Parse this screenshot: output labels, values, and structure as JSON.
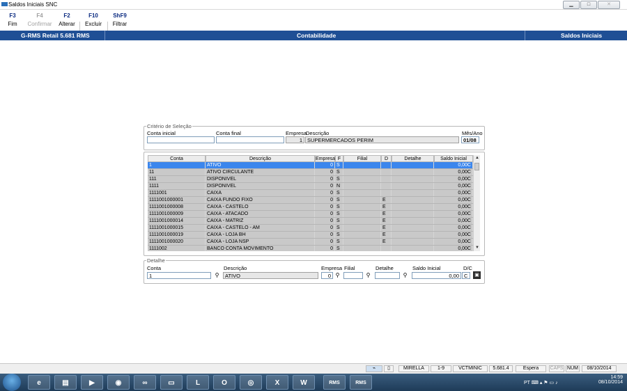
{
  "window": {
    "title": "Saldos Iniciais SNC",
    "min": "▁",
    "max": "□",
    "close": "✕"
  },
  "toolbar": [
    {
      "key": "F3",
      "label": "Fim",
      "disabled": false
    },
    {
      "key": "F4",
      "label": "Confirmar",
      "disabled": true
    },
    {
      "key": "F2",
      "label": "Alterar",
      "disabled": false
    },
    {
      "key": "F10",
      "label": "Excluir",
      "disabled": false
    },
    {
      "key": "ShF9",
      "label": "Filtrar",
      "disabled": false
    }
  ],
  "sysbar": {
    "product": "G-RMS Retail 5.681 RMS",
    "module": "Contabilidade",
    "screen": "Saldos Iniciais"
  },
  "criteria": {
    "legend": "Critério de Seleção",
    "conta_inicial_label": "Conta inicial",
    "conta_inicial": "",
    "conta_final_label": "Conta final",
    "conta_final": "",
    "empresa_label": "Empresa",
    "empresa": "1",
    "descricao_label": "Descrição",
    "descricao": "SUPERMERCADOS PERIM",
    "mes_ano_label": "Mês/Ano",
    "mes_ano": "01/08"
  },
  "grid": {
    "headers": [
      "Conta",
      "Descrição",
      "Empresa",
      "F",
      "Filial",
      "D",
      "Detalhe",
      "Saldo Inicial"
    ],
    "rows": [
      {
        "conta": "1",
        "descricao": "ATIVO",
        "empresa": "0",
        "f": "S",
        "filial": "",
        "d": "",
        "detalhe": "",
        "saldo": "0,00C"
      },
      {
        "conta": "11",
        "descricao": "ATIVO CIRCULANTE",
        "empresa": "0",
        "f": "S",
        "filial": "",
        "d": "",
        "detalhe": "",
        "saldo": "0,00C"
      },
      {
        "conta": "111",
        "descricao": "DISPONIVEL",
        "empresa": "0",
        "f": "S",
        "filial": "",
        "d": "",
        "detalhe": "",
        "saldo": "0,00C"
      },
      {
        "conta": "1111",
        "descricao": "DISPONIVEL",
        "empresa": "0",
        "f": "N",
        "filial": "",
        "d": "",
        "detalhe": "",
        "saldo": "0,00C"
      },
      {
        "conta": "1111001",
        "descricao": "CAIXA",
        "empresa": "0",
        "f": "S",
        "filial": "",
        "d": "",
        "detalhe": "",
        "saldo": "0,00C"
      },
      {
        "conta": "1111001000001",
        "descricao": "CAIXA FUNDO FIXO",
        "empresa": "0",
        "f": "S",
        "filial": "",
        "d": "E",
        "detalhe": "",
        "saldo": "0,00C"
      },
      {
        "conta": "1111001000008",
        "descricao": "CAIXA - CASTELO",
        "empresa": "0",
        "f": "S",
        "filial": "",
        "d": "E",
        "detalhe": "",
        "saldo": "0,00C"
      },
      {
        "conta": "1111001000009",
        "descricao": "CAIXA - ATACADO",
        "empresa": "0",
        "f": "S",
        "filial": "",
        "d": "E",
        "detalhe": "",
        "saldo": "0,00C"
      },
      {
        "conta": "1111001000014",
        "descricao": "CAIXA - MATRIZ",
        "empresa": "0",
        "f": "S",
        "filial": "",
        "d": "E",
        "detalhe": "",
        "saldo": "0,00C"
      },
      {
        "conta": "1111001000015",
        "descricao": "CAIXA - CASTELO - AM",
        "empresa": "0",
        "f": "S",
        "filial": "",
        "d": "E",
        "detalhe": "",
        "saldo": "0,00C"
      },
      {
        "conta": "1111001000019",
        "descricao": "CAIXA - LOJA BH",
        "empresa": "0",
        "f": "S",
        "filial": "",
        "d": "E",
        "detalhe": "",
        "saldo": "0,00C"
      },
      {
        "conta": "1111001000020",
        "descricao": "CAIXA - LOJA NSP",
        "empresa": "0",
        "f": "S",
        "filial": "",
        "d": "E",
        "detalhe": "",
        "saldo": "0,00C"
      },
      {
        "conta": "1111002",
        "descricao": "BANCO CONTA MOVIMENTO",
        "empresa": "0",
        "f": "S",
        "filial": "",
        "d": "",
        "detalhe": "",
        "saldo": "0,00C"
      }
    ]
  },
  "detail": {
    "legend": "Detalhe",
    "conta_label": "Conta",
    "conta": "1",
    "descricao_label": "Descrição",
    "descricao": "ATIVO",
    "empresa_label": "Empresa",
    "empresa": "0",
    "filial_label": "Filial",
    "filial": "",
    "detalhe_label": "Detalhe",
    "detalhe": "",
    "saldo_label": "Saldo Inicial",
    "saldo": "0,00",
    "dc_label": "D/C",
    "dc": "C"
  },
  "statusbar": {
    "user": "MIRELLA",
    "range": "1-9",
    "program": "VCTMINIC",
    "version": "5.681.4",
    "state": "Espera",
    "caps": "CAPS",
    "num": "NUM",
    "date": "08/10/2014"
  },
  "taskbar": {
    "apps": [
      {
        "name": "ie",
        "glyph": "e"
      },
      {
        "name": "explorer",
        "glyph": "▤"
      },
      {
        "name": "media",
        "glyph": "▶"
      },
      {
        "name": "chrome",
        "glyph": "◉"
      },
      {
        "name": "app-blue",
        "glyph": "∞"
      },
      {
        "name": "folder",
        "glyph": "▭"
      },
      {
        "name": "lync",
        "glyph": "L"
      },
      {
        "name": "outlook",
        "glyph": "O"
      },
      {
        "name": "app-circle",
        "glyph": "◎"
      },
      {
        "name": "excel",
        "glyph": "X"
      },
      {
        "name": "word",
        "glyph": "W"
      },
      {
        "name": "rms-1",
        "glyph": "RMS"
      },
      {
        "name": "rms-2",
        "glyph": "RMS"
      }
    ],
    "lang": "PT",
    "time": "14:59",
    "date": "08/10/2014"
  },
  "colors": {
    "sysbar": "#1f4f95",
    "selected_row": "#3b86ed",
    "row": "#c9c9c9"
  }
}
